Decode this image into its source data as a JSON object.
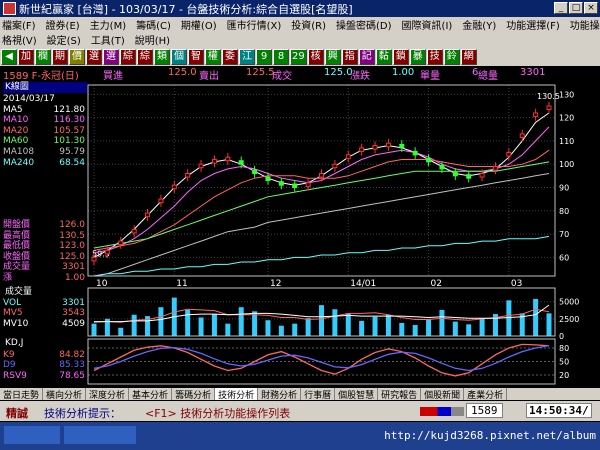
{
  "window": {
    "title": "新世紀贏家 [台灣] - 103/03/17 - 台盤技術分析:綜合自選股[名望股]",
    "buttons": [
      "_",
      "□",
      "×"
    ]
  },
  "menu": {
    "row1": [
      "檔案(F)",
      "證券(E)",
      "主力(M)",
      "籌碼(C)",
      "期權(O)",
      "匯市行情(X)",
      "投資(R)",
      "操盤密碼(D)",
      "國際資訊(I)",
      "金融(Y)",
      "功能選擇(F)",
      "功能操作(E)"
    ],
    "row2": [
      "格視(V)",
      "設定(S)",
      "工具(T)",
      "說明(H)"
    ]
  },
  "toolbar": {
    "buttons": [
      {
        "label": "◀",
        "color": "#008000"
      },
      {
        "label": "加",
        "color": "#800000"
      },
      {
        "label": "欄",
        "color": "#008000"
      },
      {
        "label": "期",
        "color": "#800000"
      },
      {
        "label": "價",
        "color": "#808000"
      },
      {
        "label": "選",
        "color": "#800000"
      },
      {
        "label": "選",
        "color": "#800080"
      },
      {
        "label": "綜",
        "color": "#800000"
      },
      {
        "label": "綜",
        "color": "#800000"
      },
      {
        "label": "類",
        "color": "#008000"
      },
      {
        "label": "個",
        "color": "#008080"
      },
      {
        "label": "智",
        "color": "#800000"
      },
      {
        "label": "權",
        "color": "#008000"
      },
      {
        "label": "委",
        "color": "#800000"
      },
      {
        "label": "江",
        "color": "#008080"
      },
      {
        "label": "9",
        "color": "#008000"
      },
      {
        "label": "8",
        "color": "#008000"
      },
      {
        "label": "29",
        "color": "#008000"
      },
      {
        "label": "核",
        "color": "#800000"
      },
      {
        "label": "興",
        "color": "#008000"
      },
      {
        "label": "指",
        "color": "#800000"
      },
      {
        "label": "記",
        "color": "#800080"
      },
      {
        "label": "黏",
        "color": "#008000"
      },
      {
        "label": "鎖",
        "color": "#800000"
      },
      {
        "label": "暴",
        "color": "#008000"
      },
      {
        "label": "技",
        "color": "#800000"
      },
      {
        "label": "鈴",
        "color": "#008000"
      },
      {
        "label": "網",
        "color": "#800000"
      }
    ]
  },
  "quote": {
    "symbol": "1589 F-永冠(日)",
    "buy_label": "買進",
    "buy_value": "125.0",
    "sell_label": "賣出",
    "sell_value": "125.5",
    "trade_label": "成交",
    "trade_value": "125.0",
    "change_label": "漲跌",
    "change_value": "1.00",
    "volume_label": "單量",
    "volume_value": "6",
    "total_label": "總量",
    "total_value": "3301"
  },
  "panel": {
    "title": "K線圖",
    "date": "2014/03/17",
    "ma": [
      {
        "name": "MA5",
        "value": "121.80",
        "color": "#ffffff"
      },
      {
        "name": "MA10",
        "value": "116.30",
        "color": "#ff66ff"
      },
      {
        "name": "MA20",
        "value": "105.57",
        "color": "#ff6666"
      },
      {
        "name": "MA60",
        "value": "101.30",
        "color": "#66ff66"
      },
      {
        "name": "MA108",
        "value": "95.79",
        "color": "#c0c0c0"
      },
      {
        "name": "MA240",
        "value": "68.54",
        "color": "#66ffff"
      }
    ],
    "prices": [
      {
        "name": "開盤價",
        "value": "126.0"
      },
      {
        "name": "最高價",
        "value": "130.5"
      },
      {
        "name": "最低價",
        "value": "123.0"
      },
      {
        "name": "收盤價",
        "value": "125.0"
      },
      {
        "name": "成交量",
        "value": "3301"
      },
      {
        "name": "漲",
        "value": "1.00"
      }
    ]
  },
  "volume_panel": {
    "title": "成交量",
    "items": [
      {
        "name": "VOL",
        "value": "3301",
        "color": "#66ffff"
      },
      {
        "name": "MV5",
        "value": "3543",
        "color": "#ff6666"
      },
      {
        "name": "MV10",
        "value": "4509",
        "color": "#ffffff"
      }
    ]
  },
  "kd_panel": {
    "title": "KD,J",
    "items": [
      {
        "name": "K9",
        "value": "84.82",
        "color": "#ff6666"
      },
      {
        "name": "D9",
        "value": "85.33",
        "color": "#6666ff"
      },
      {
        "name": "RSV9",
        "value": "78.65",
        "color": "#ff66ff"
      }
    ]
  },
  "chart_data": [
    {
      "type": "line",
      "title": "K線圖",
      "x_ticks": [
        "10",
        "11",
        "12",
        "14/01",
        "02",
        "03"
      ],
      "y_ticks": [
        60,
        70,
        80,
        90,
        100,
        110,
        120,
        130
      ],
      "ylim": [
        52,
        134
      ],
      "annotations": [
        {
          "label": "130.5",
          "value": 130.5
        },
        {
          "label": "59.5",
          "value": 59.5
        }
      ],
      "series": [
        {
          "name": "MA5",
          "color": "#ffffff",
          "values": [
            60,
            63,
            67,
            72,
            78,
            84,
            90,
            95,
            99,
            101,
            102,
            100,
            97,
            94,
            92,
            91,
            92,
            95,
            99,
            103,
            106,
            107,
            108,
            107,
            105,
            102,
            99,
            96,
            95,
            96,
            98,
            103,
            110,
            118,
            122
          ]
        },
        {
          "name": "MA10",
          "color": "#ff66ff",
          "values": [
            62,
            63,
            65,
            68,
            72,
            77,
            82,
            88,
            93,
            96,
            98,
            99,
            98,
            96,
            94,
            93,
            92,
            93,
            96,
            99,
            102,
            104,
            105,
            106,
            105,
            103,
            100,
            98,
            97,
            97,
            98,
            100,
            104,
            110,
            116
          ]
        },
        {
          "name": "MA20",
          "color": "#ff6666",
          "values": [
            63,
            64,
            65,
            66,
            68,
            71,
            74,
            78,
            82,
            86,
            89,
            92,
            94,
            95,
            95,
            95,
            94,
            94,
            94,
            95,
            97,
            99,
            101,
            102,
            102,
            102,
            101,
            100,
            99,
            99,
            99,
            99,
            100,
            102,
            106
          ]
        },
        {
          "name": "MA60",
          "color": "#66ff66",
          "values": [
            64,
            65,
            66,
            67,
            68,
            70,
            72,
            74,
            76,
            78,
            80,
            82,
            84,
            86,
            87,
            88,
            89,
            90,
            91,
            92,
            93,
            94,
            95,
            96,
            97,
            97,
            97,
            97,
            97,
            97,
            97,
            98,
            99,
            100,
            101
          ]
        },
        {
          "name": "MA108",
          "color": "#c0c0c0",
          "values": [
            52,
            53,
            55,
            57,
            59,
            61,
            63,
            65,
            67,
            69,
            71,
            72,
            73,
            75,
            76,
            77,
            78,
            79,
            80,
            81,
            82,
            83,
            84,
            85,
            86,
            87,
            88,
            89,
            90,
            91,
            92,
            93,
            94,
            95,
            96
          ]
        },
        {
          "name": "MA240",
          "color": "#66ffff",
          "values": [
            52,
            53,
            53,
            54,
            54,
            55,
            55,
            56,
            56,
            57,
            57,
            58,
            58,
            59,
            59,
            60,
            60,
            61,
            61,
            62,
            62,
            63,
            63,
            64,
            64,
            65,
            65,
            66,
            66,
            67,
            67,
            68,
            68,
            68,
            69
          ]
        }
      ],
      "candles": [
        60,
        63,
        67,
        72,
        79,
        85,
        91,
        96,
        100,
        102,
        103,
        100,
        96,
        93,
        91,
        90,
        92,
        96,
        100,
        104,
        107,
        108,
        109,
        107,
        104,
        101,
        98,
        95,
        94,
        96,
        99,
        105,
        113,
        122,
        125
      ]
    },
    {
      "type": "bar",
      "title": "成交量",
      "ylim": [
        0,
        7000
      ],
      "y_ticks": [
        0,
        2500,
        5000
      ],
      "values": [
        1800,
        2500,
        1200,
        3100,
        2900,
        4200,
        5600,
        3800,
        2700,
        3200,
        1800,
        4200,
        3600,
        2300,
        1500,
        1800,
        2600,
        4500,
        3900,
        3300,
        2200,
        2800,
        3100,
        1900,
        1600,
        2400,
        3800,
        2100,
        1700,
        2600,
        3200,
        5200,
        3300,
        5400,
        3301
      ],
      "series": [
        {
          "name": "MV5",
          "color": "#ff6666",
          "values": [
            2000,
            2100,
            2000,
            2300,
            2400,
            2800,
            3500,
            3900,
            3800,
            3700,
            3100,
            3100,
            3100,
            3000,
            2700,
            2700,
            2400,
            2500,
            2900,
            3300,
            3300,
            3400,
            3100,
            2700,
            2400,
            2400,
            2600,
            2400,
            2300,
            2500,
            2700,
            3000,
            3200,
            3900,
            3543
          ]
        },
        {
          "name": "MV10",
          "color": "#ffffff",
          "values": [
            2100,
            2100,
            2100,
            2200,
            2200,
            2400,
            2800,
            3100,
            3200,
            3200,
            3100,
            3200,
            3300,
            3300,
            3200,
            3000,
            2800,
            2800,
            2900,
            3000,
            2900,
            2900,
            2900,
            2900,
            2800,
            2700,
            2800,
            2700,
            2600,
            2600,
            2600,
            2700,
            2800,
            3100,
            4509
          ]
        }
      ]
    },
    {
      "type": "line",
      "title": "KD,J",
      "ylim": [
        0,
        100
      ],
      "y_ticks": [
        20,
        50,
        80
      ],
      "series": [
        {
          "name": "K9",
          "color": "#ff6666",
          "values": [
            30,
            45,
            60,
            75,
            82,
            85,
            80,
            70,
            55,
            40,
            30,
            35,
            50,
            65,
            72,
            60,
            45,
            30,
            22,
            35,
            55,
            70,
            78,
            72,
            58,
            40,
            25,
            18,
            25,
            45,
            65,
            80,
            88,
            87,
            84.82
          ]
        },
        {
          "name": "D9",
          "color": "#6666ff",
          "values": [
            35,
            40,
            50,
            62,
            72,
            79,
            81,
            77,
            68,
            56,
            45,
            40,
            44,
            53,
            62,
            64,
            58,
            48,
            38,
            36,
            43,
            55,
            66,
            71,
            68,
            58,
            46,
            35,
            30,
            35,
            46,
            60,
            72,
            80,
            85.33
          ]
        }
      ]
    }
  ],
  "tabs": [
    "當日走勢",
    "橫向分析",
    "深度分析",
    "基本分析",
    "籌碼分析",
    "技術分析",
    "財務分析",
    "行事曆",
    "個股智慧",
    "研究報告",
    "個股新聞",
    "產業分析"
  ],
  "active_tab": "技術分析",
  "status": {
    "left": "精誠",
    "hint_label": "技術分析提示：",
    "hint_text": "<F1> 技術分析功能操作列表",
    "code": "1589",
    "time": "14:50:34/"
  },
  "taskbar": {
    "url": "http://kujd3268.pixnet.net/album"
  }
}
